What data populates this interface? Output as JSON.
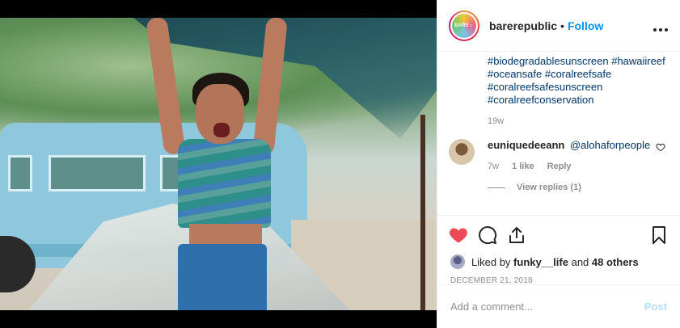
{
  "post": {
    "username": "barerepublic",
    "separator": "•",
    "follow_label": "Follow",
    "avatar_text": "BARE☼",
    "hashtags": [
      "#biodegradablesunscreen #hawaiireef",
      "#oceansafe #coralreefsafe",
      "#coralreefsafesunscreen",
      "#coralreefconservation"
    ],
    "caption_time": "19w"
  },
  "comment": {
    "username": "euniquedeeann",
    "mention": "@alohaforpeople",
    "time": "7w",
    "likes": "1 like",
    "reply_label": "Reply",
    "view_replies": "View replies (1)"
  },
  "liked_by": {
    "prefix": "Liked by",
    "user": "funky__life",
    "middle": "and",
    "others": "48 others"
  },
  "date": "DECEMBER 21, 2018",
  "add_comment": {
    "placeholder": "Add a comment...",
    "post_label": "Post"
  },
  "colors": {
    "link": "#00376b",
    "follow": "#0095f6",
    "like_red": "#ed4956",
    "post_disabled": "#b2dffc"
  },
  "icons": {
    "liked": "heart-filled-icon",
    "comment": "comment-bubble-icon",
    "share": "share-icon",
    "save": "bookmark-icon",
    "more": "more-options-icon",
    "comment_like": "heart-outline-icon"
  }
}
